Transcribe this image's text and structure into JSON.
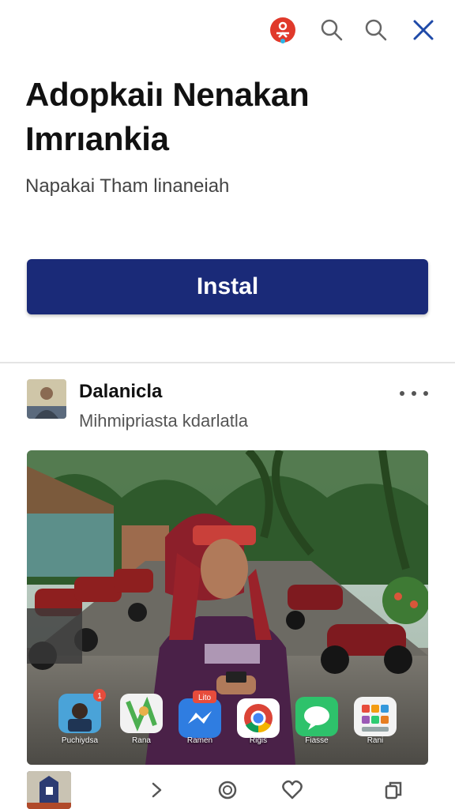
{
  "header": {
    "brand_icon": "brand-logo-icon",
    "search_icon": "search-icon",
    "close_icon": "close-icon"
  },
  "ad": {
    "headline_line1": "Adopkaiı Nenakan",
    "headline_line2": "Imrıankia",
    "subtitle": "Napakai Tham linaneiah",
    "install_label": "Instal",
    "install_color": "#1a2a78"
  },
  "post": {
    "author": "Dalanicla",
    "meta": "Mihmipriasta kdarlatla"
  },
  "photo_apps": [
    {
      "label": "Puchiydsa",
      "icon": "contact-icon",
      "badge": "1"
    },
    {
      "label": "Rana",
      "icon": "maps-icon",
      "badge": ""
    },
    {
      "label": "Ramen",
      "icon": "messenger-icon",
      "badge": "Lito"
    },
    {
      "label": "Rigis",
      "icon": "chrome-icon",
      "badge": ""
    },
    {
      "label": "Fiasse",
      "icon": "chat-bubble-icon",
      "badge": ""
    },
    {
      "label": "Rani",
      "icon": "app-grid-icon",
      "badge": ""
    }
  ],
  "bottom_nav": {
    "items": [
      "thumbnail",
      "forward-icon",
      "circle-icon",
      "heart-icon",
      "copy-icon"
    ]
  }
}
